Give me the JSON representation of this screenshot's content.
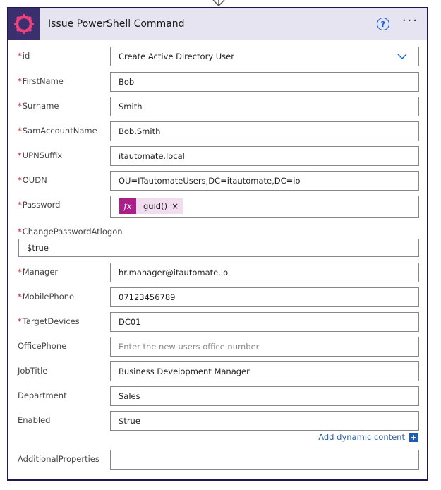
{
  "header": {
    "title": "Issue PowerShell Command",
    "help_glyph": "?",
    "more_glyph": "···"
  },
  "fields": {
    "id": {
      "label": "id",
      "value": "Create Active Directory User"
    },
    "firstname": {
      "label": "FirstName",
      "value": "Bob"
    },
    "surname": {
      "label": "Surname",
      "value": "Smith"
    },
    "samaccountname": {
      "label": "SamAccountName",
      "value": "Bob.Smith"
    },
    "upnsuffix": {
      "label": "UPNSuffix",
      "value": "itautomate.local"
    },
    "oudn": {
      "label": "OUDN",
      "value": "OU=ITautomateUsers,DC=itautomate,DC=io"
    },
    "password": {
      "label": "Password",
      "token_text": "guid()",
      "token_close": "×",
      "fx_glyph": "fx"
    },
    "changepassword": {
      "label": "ChangePasswordAtlogon",
      "value": "$true"
    },
    "manager": {
      "label": "Manager",
      "value": "hr.manager@itautomate.io"
    },
    "mobilephone": {
      "label": "MobilePhone",
      "value": "07123456789"
    },
    "targetdevices": {
      "label": "TargetDevices",
      "value": "DC01"
    },
    "officephone": {
      "label": "OfficePhone",
      "value": "",
      "placeholder": "Enter the new users office number"
    },
    "jobtitle": {
      "label": "JobTitle",
      "value": "Business Development Manager"
    },
    "department": {
      "label": "Department",
      "value": "Sales"
    },
    "enabled": {
      "label": "Enabled",
      "value": "$true"
    },
    "additionalproperties": {
      "label": "AdditionalProperties",
      "value": ""
    }
  },
  "dynamic": {
    "label": "Add dynamic content",
    "plus_glyph": "+"
  },
  "required_marker": "*",
  "colors": {
    "header_bg": "#e5e4f0",
    "logo_bg": "#3c2f6e",
    "logo_ring": "#e8417f",
    "border": "#1f1654",
    "required": "#c50f1f",
    "link": "#2b5fa8",
    "fx_bg": "#aa1f8a"
  },
  "icons": {
    "logo": "gear-ring-icon",
    "help": "question-circle-icon",
    "more": "ellipsis-icon",
    "chevron": "chevron-down-icon",
    "fx": "function-icon",
    "plus": "plus-icon"
  }
}
